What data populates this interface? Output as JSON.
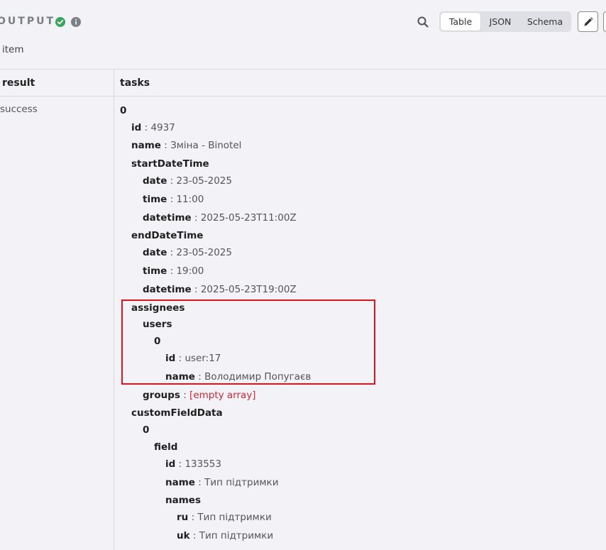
{
  "header": {
    "title": "OUTPUT",
    "view_tabs": [
      {
        "label": "Table",
        "active": true
      },
      {
        "label": "JSON",
        "active": false
      },
      {
        "label": "Schema",
        "active": false
      }
    ],
    "item_count": "item"
  },
  "columns": {
    "result": "result",
    "tasks": "tasks"
  },
  "row": {
    "result_value": "success"
  },
  "tree": [
    {
      "indent": 0,
      "key": "0"
    },
    {
      "indent": 1,
      "key": "id",
      "value": "4937"
    },
    {
      "indent": 1,
      "key": "name",
      "value": "Зміна - Binotel"
    },
    {
      "indent": 1,
      "key": "startDateTime"
    },
    {
      "indent": 2,
      "key": "date",
      "value": "23-05-2025"
    },
    {
      "indent": 2,
      "key": "time",
      "value": "11:00"
    },
    {
      "indent": 2,
      "key": "datetime",
      "value": "2025-05-23T11:00Z"
    },
    {
      "indent": 1,
      "key": "endDateTime"
    },
    {
      "indent": 2,
      "key": "date",
      "value": "23-05-2025"
    },
    {
      "indent": 2,
      "key": "time",
      "value": "19:00"
    },
    {
      "indent": 2,
      "key": "datetime",
      "value": "2025-05-23T19:00Z"
    },
    {
      "indent": 1,
      "key": "assignees"
    },
    {
      "indent": 2,
      "key": "users"
    },
    {
      "indent": 3,
      "key": "0"
    },
    {
      "indent": 4,
      "key": "id",
      "value": "user:17"
    },
    {
      "indent": 4,
      "key": "name",
      "value": "Володимир Попугаєв"
    },
    {
      "indent": 2,
      "key": "groups",
      "value": "[empty array]",
      "empty": true
    },
    {
      "indent": 1,
      "key": "customFieldData"
    },
    {
      "indent": 2,
      "key": "0"
    },
    {
      "indent": 3,
      "key": "field"
    },
    {
      "indent": 4,
      "key": "id",
      "value": "133553"
    },
    {
      "indent": 4,
      "key": "name",
      "value": "Тип підтримки"
    },
    {
      "indent": 4,
      "key": "names"
    },
    {
      "indent": 5,
      "key": "ru",
      "value": "Тип підтримки"
    },
    {
      "indent": 5,
      "key": "uk",
      "value": "Тип підтримки"
    }
  ],
  "colors": {
    "success": "#3aa55d",
    "empty_value": "#d1283a",
    "highlight": "#d9161d"
  }
}
